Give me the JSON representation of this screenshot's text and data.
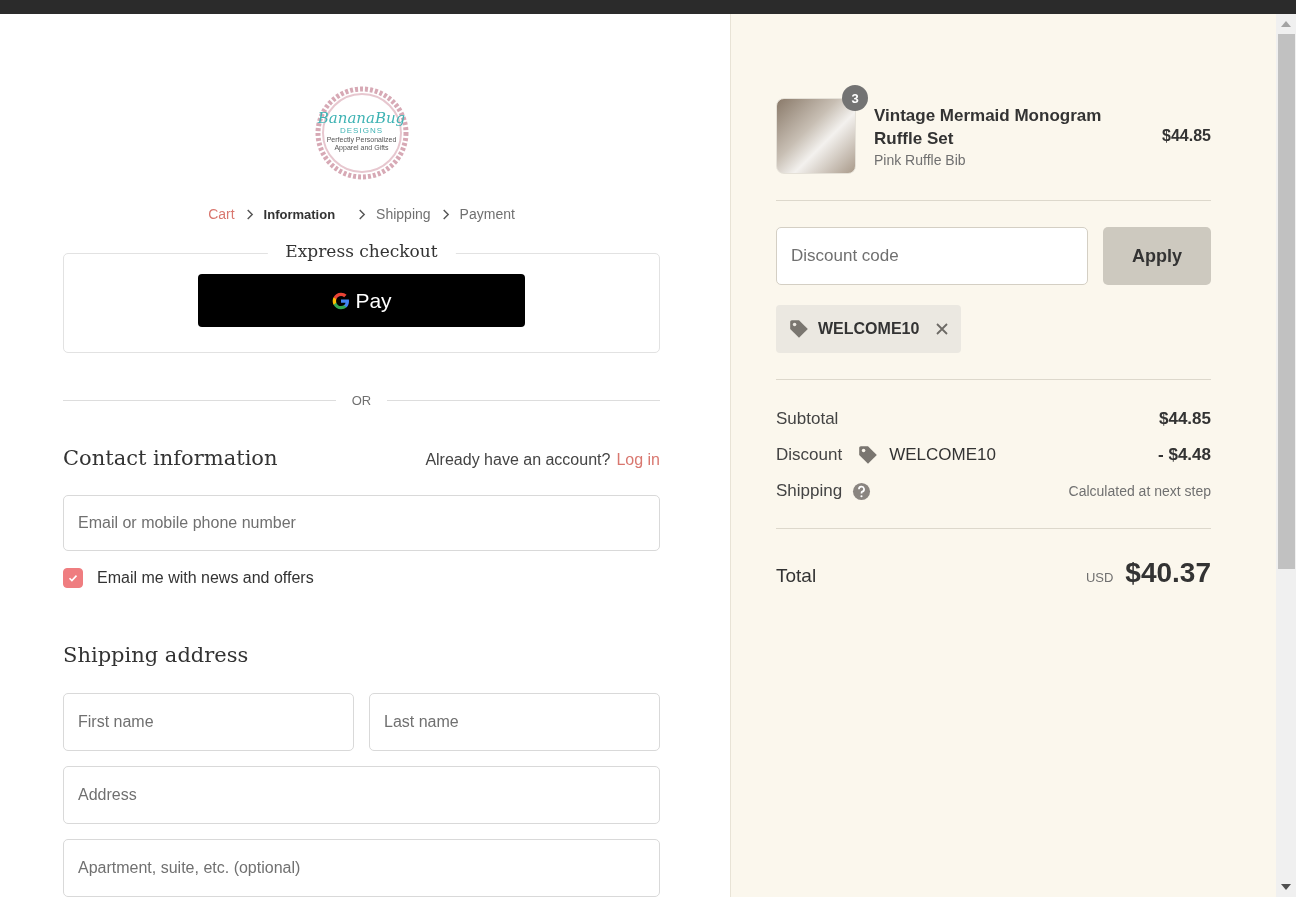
{
  "logo": {
    "name": "BananaBug",
    "sub": "DESIGNS",
    "tagline": "Perfectly Personalized Apparel and Gifts"
  },
  "breadcrumb": [
    {
      "label": "Cart",
      "kind": "link",
      "selected": false
    },
    {
      "label": "Information",
      "kind": "step",
      "selected": true
    },
    {
      "label": "Shipping",
      "kind": "step",
      "selected": false
    },
    {
      "label": "Payment",
      "kind": "step",
      "selected": false
    }
  ],
  "express": {
    "title": "Express checkout",
    "button": "Pay",
    "divider": "OR"
  },
  "contact": {
    "title": "Contact information",
    "prompt": "Already have an account?",
    "login": "Log in",
    "email_placeholder": "Email or mobile phone number",
    "newsletter": {
      "label": "Email me with news and offers",
      "checked": true
    }
  },
  "shipping_address": {
    "title": "Shipping address",
    "fields": [
      {
        "placeholder": "First name",
        "half": true
      },
      {
        "placeholder": "Last name",
        "half": true
      },
      {
        "placeholder": "Address",
        "half": false
      },
      {
        "placeholder": "Apartment, suite, etc. (optional)",
        "half": false
      }
    ]
  },
  "summary": {
    "item": {
      "name": "Vintage Mermaid Monogram Ruffle Set",
      "variant": "Pink Ruffle Bib",
      "quantity": "3",
      "price": "$44.85"
    },
    "discount": {
      "placeholder": "Discount code",
      "button": "Apply",
      "applied": "WELCOME10"
    },
    "lines": [
      {
        "label": "Subtotal",
        "kind": "plain",
        "value": "$44.85"
      },
      {
        "label": "Discount",
        "kind": "code",
        "code": "WELCOME10",
        "value": "- $4.48"
      },
      {
        "label": "Shipping",
        "kind": "help",
        "value": "Calculated at next step"
      }
    ],
    "total": {
      "label": "Total",
      "currency": "USD",
      "value": "$40.37"
    }
  }
}
